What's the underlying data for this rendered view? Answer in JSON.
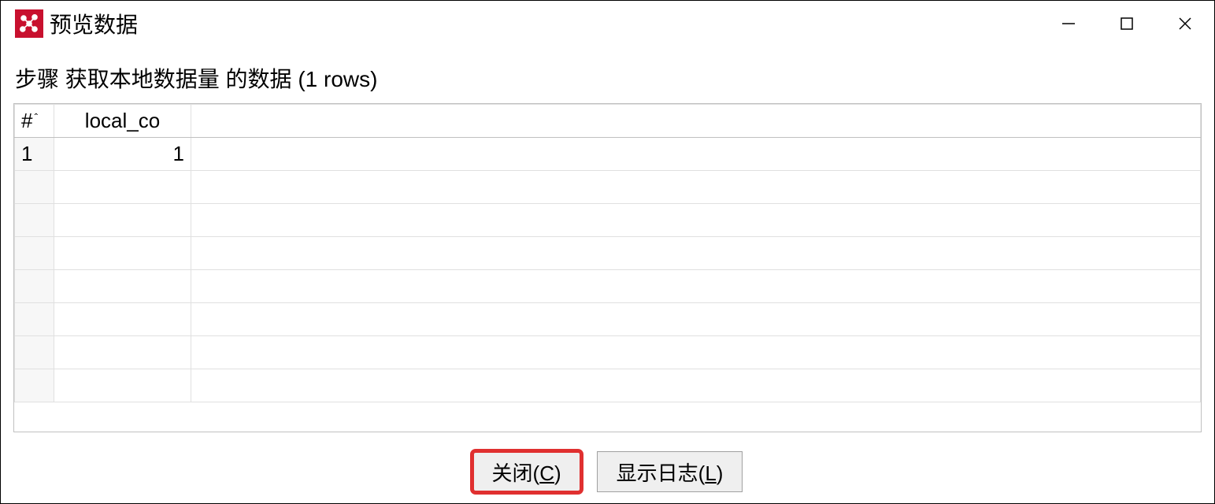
{
  "window": {
    "title": "预览数据"
  },
  "subtitle": "步骤 获取本地数据量 的数据  (1 rows)",
  "table": {
    "headers": {
      "rownum": "#",
      "col1": "local_co"
    },
    "rows": [
      {
        "rownum": "1",
        "col1": "1"
      }
    ]
  },
  "buttons": {
    "close": "关闭(",
    "close_hotkey": "C",
    "close_suffix": ")",
    "showlog": "显示日志(",
    "showlog_hotkey": "L",
    "showlog_suffix": ")"
  }
}
